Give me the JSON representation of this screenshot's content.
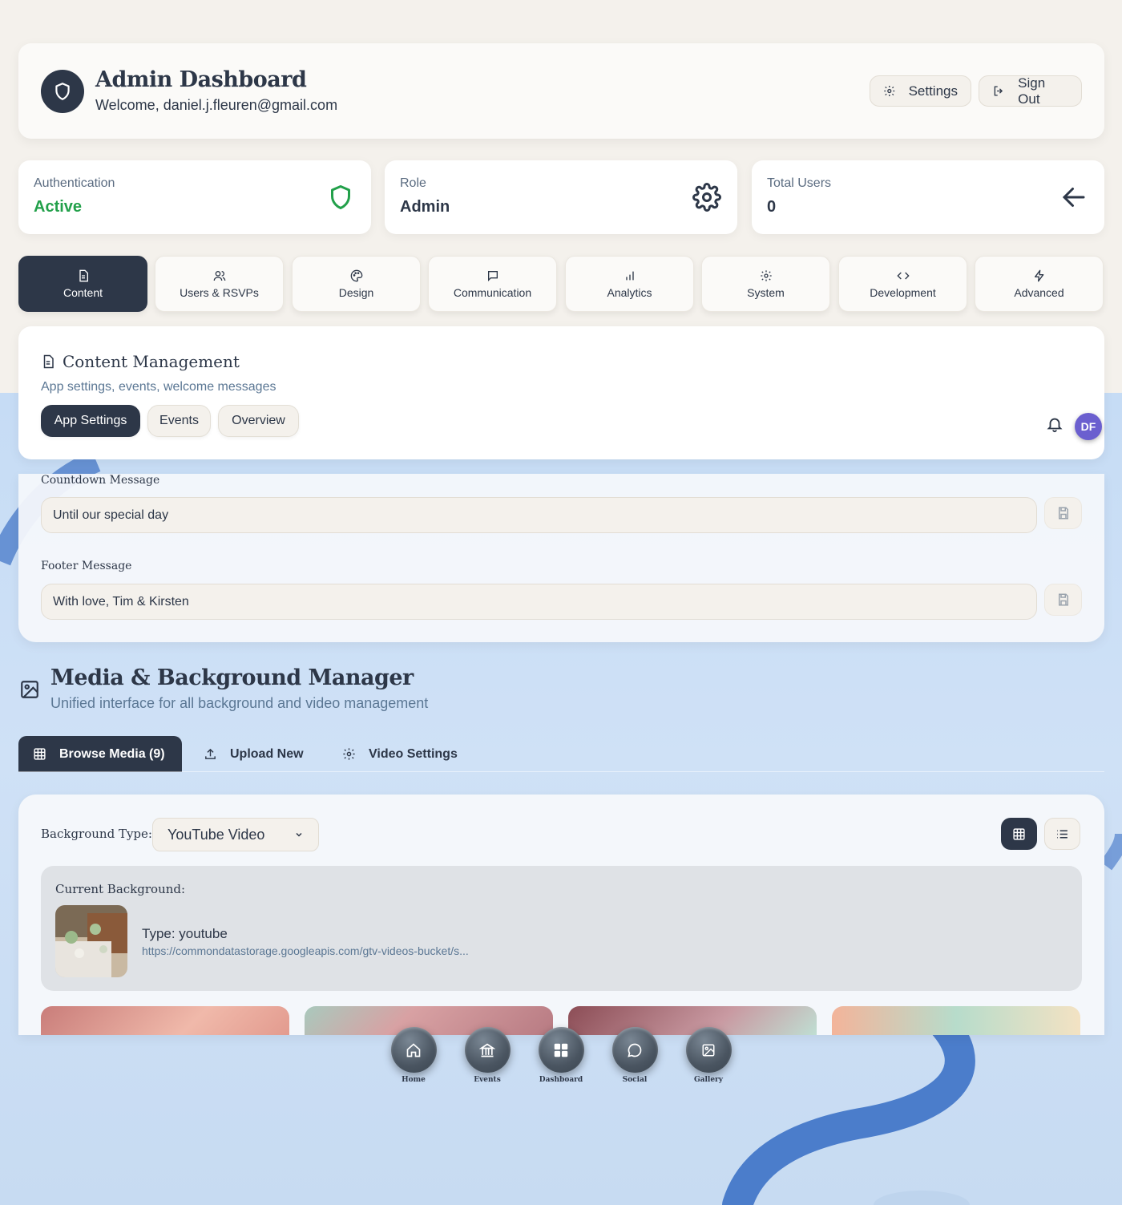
{
  "header": {
    "title": "Admin Dashboard",
    "welcome": "Welcome, daniel.j.fleuren@gmail.com",
    "settings_label": "Settings",
    "signout_label": "Sign Out"
  },
  "stats": [
    {
      "label": "Authentication",
      "value": "Active",
      "icon": "shield-icon",
      "color": "#22a04a"
    },
    {
      "label": "Role",
      "value": "Admin",
      "icon": "gear-icon"
    },
    {
      "label": "Total Users",
      "value": "0",
      "icon": "arrow-left-icon"
    }
  ],
  "tabs": [
    {
      "label": "Content",
      "icon": "document-icon",
      "active": true
    },
    {
      "label": "Users & RSVPs",
      "icon": "users-icon"
    },
    {
      "label": "Design",
      "icon": "palette-icon"
    },
    {
      "label": "Communication",
      "icon": "message-icon"
    },
    {
      "label": "Analytics",
      "icon": "bar-chart-icon"
    },
    {
      "label": "System",
      "icon": "gear-icon"
    },
    {
      "label": "Development",
      "icon": "code-icon"
    },
    {
      "label": "Advanced",
      "icon": "lightning-icon"
    }
  ],
  "content_management": {
    "title": "Content Management",
    "subtitle": "App settings, events, welcome messages",
    "subtabs": [
      "App Settings",
      "Events",
      "Overview"
    ],
    "avatar_initials": "DF"
  },
  "messages": {
    "countdown_label": "Countdown Message",
    "countdown_value": "Until our special day",
    "footer_label": "Footer Message",
    "footer_value": "With love, Tim & Kirsten"
  },
  "media_manager": {
    "title": "Media & Background Manager",
    "subtitle": "Unified interface for all background and video management",
    "tabs": [
      "Browse Media (9)",
      "Upload New",
      "Video Settings"
    ],
    "background_type_label": "Background Type:",
    "background_type_value": "YouTube Video",
    "current_background_label": "Current Background:",
    "current_type": "Type: youtube",
    "current_url": "https://commondatastorage.googleapis.com/gtv-videos-bucket/s..."
  },
  "bottom_nav": [
    "Home",
    "Events",
    "Dashboard",
    "Social",
    "Gallery"
  ],
  "colors": {
    "primary": "#2d3748",
    "accent_green": "#22a04a",
    "cream": "#f4f1ec",
    "sky": "#c9ddf3"
  }
}
